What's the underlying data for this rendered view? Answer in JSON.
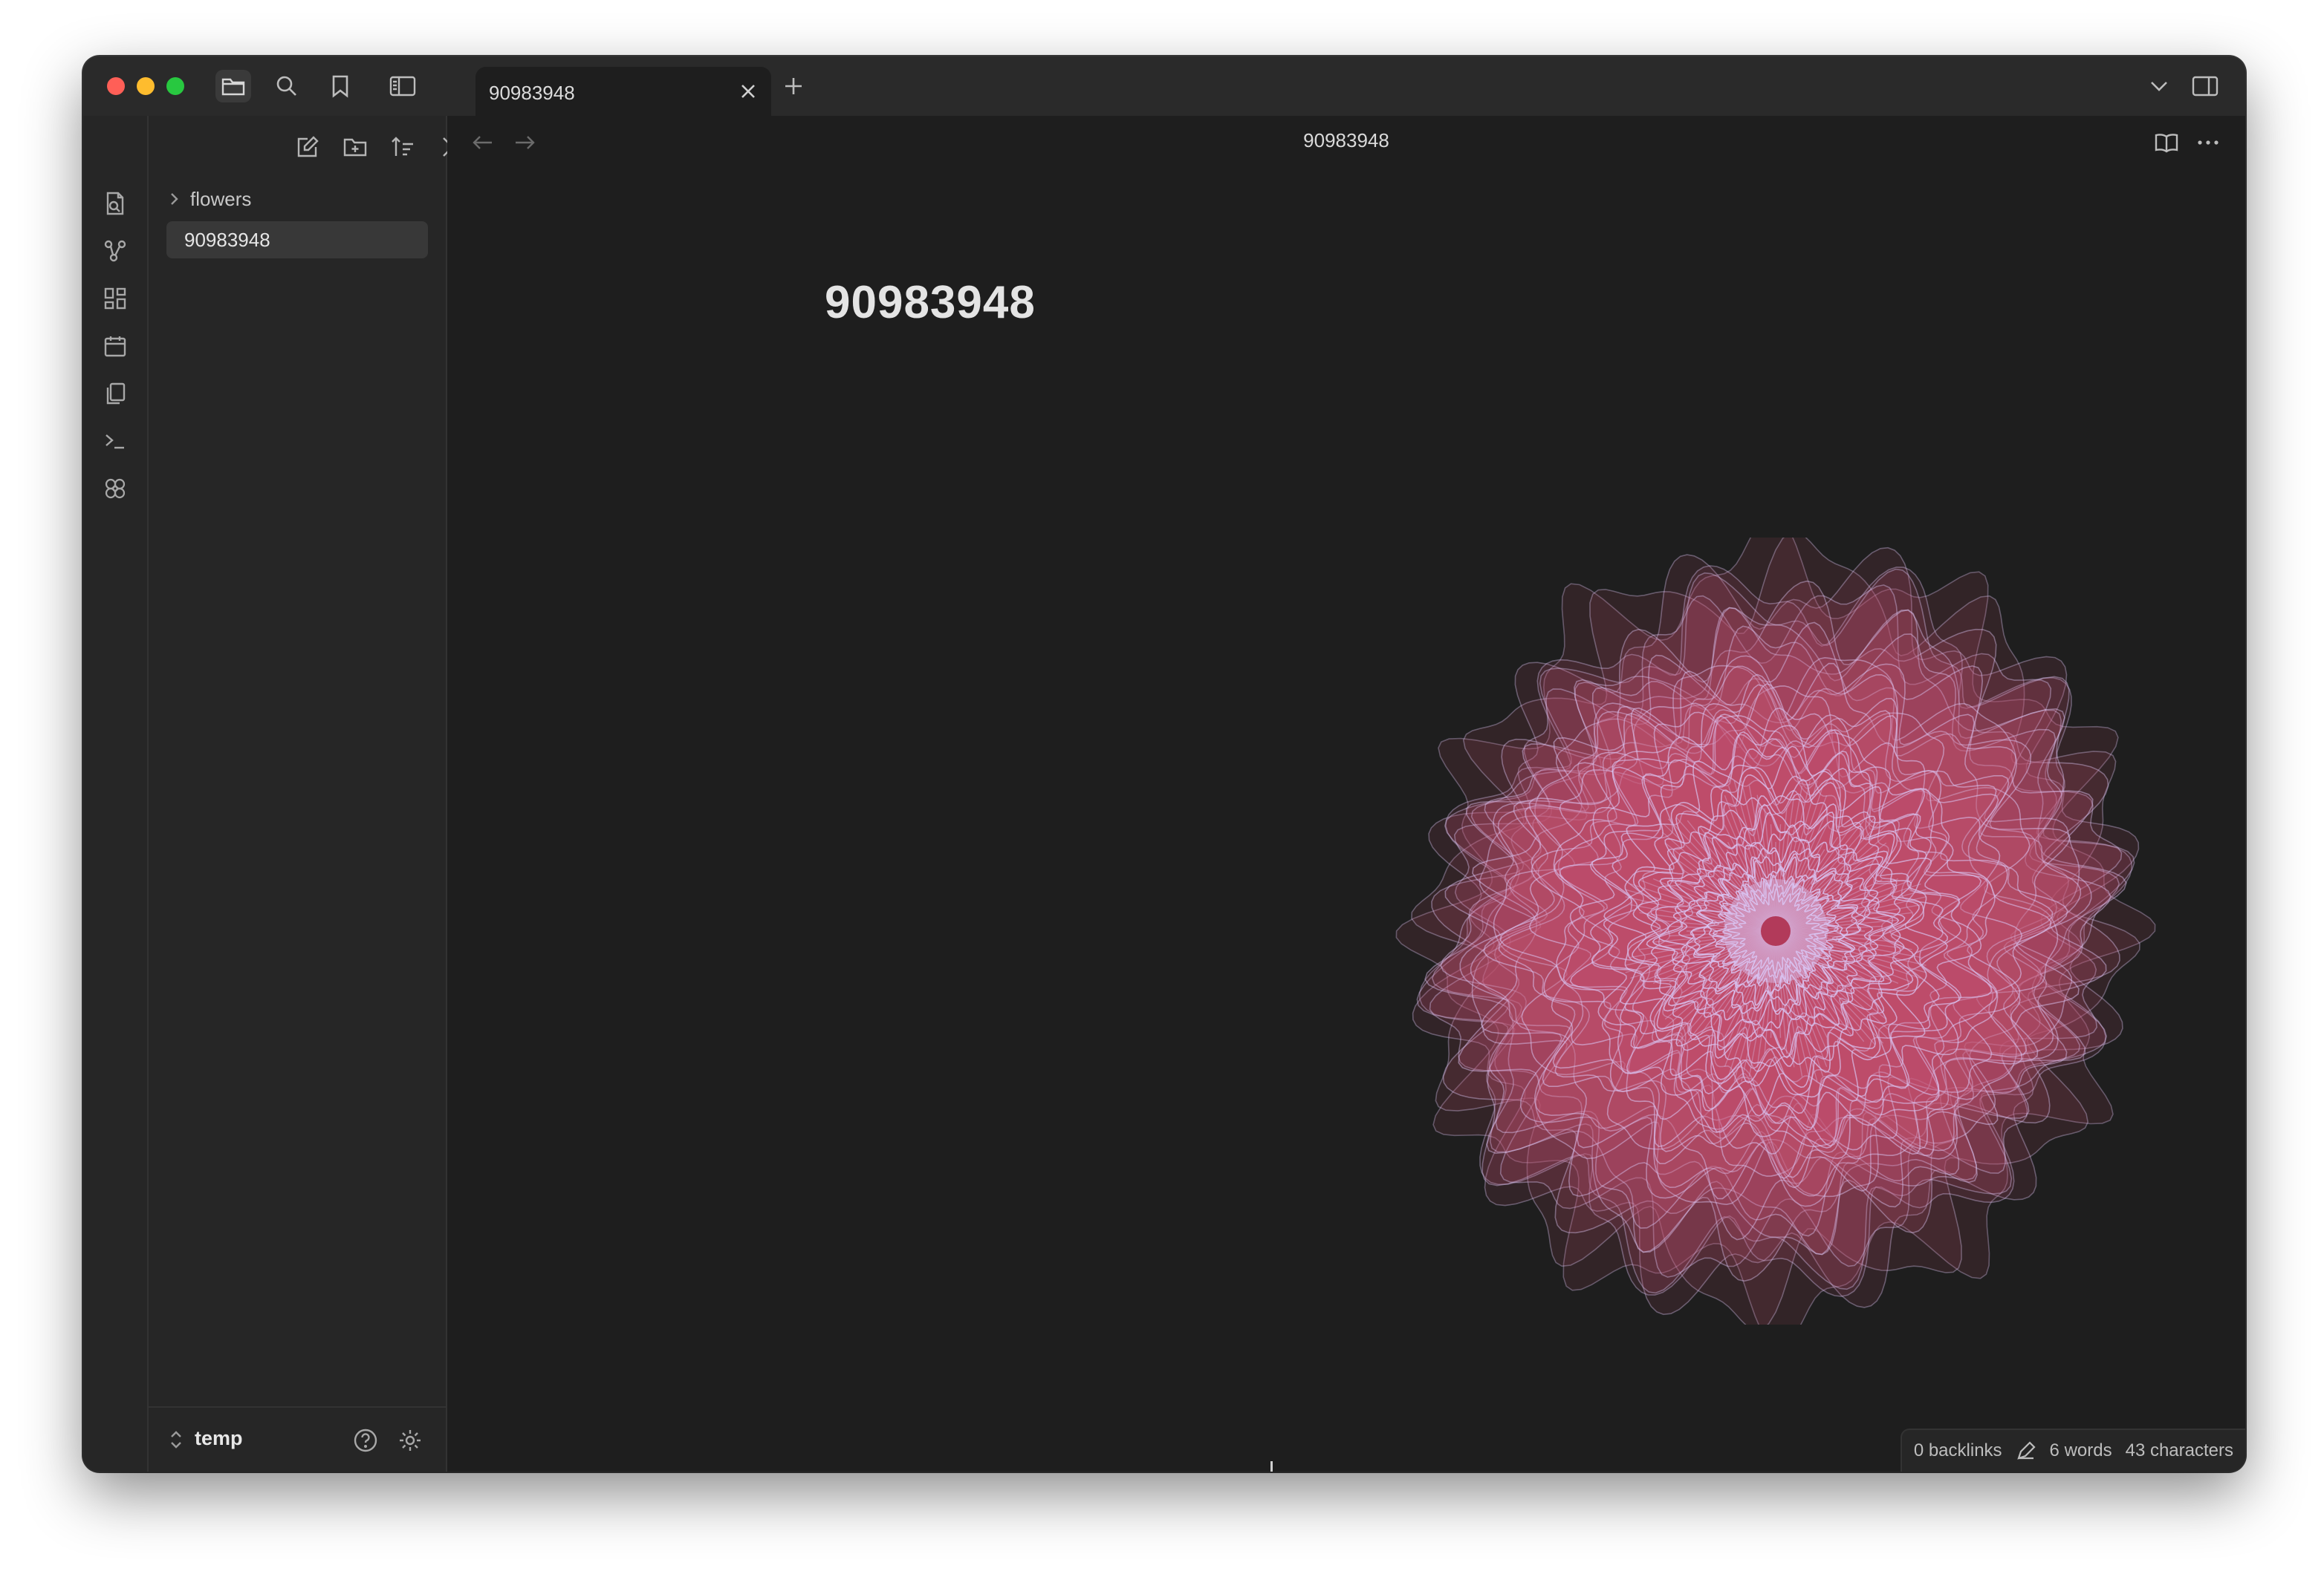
{
  "tab": {
    "title": "90983948"
  },
  "header": {
    "title": "90983948"
  },
  "sidebar": {
    "folder": "flowers",
    "file": "90983948",
    "vault": "temp"
  },
  "note": {
    "title": "90983948"
  },
  "status": {
    "backlinks": "0 backlinks",
    "words": "6 words",
    "characters": "43 characters"
  },
  "colors": {
    "petal_fill": "#c2506e",
    "petal_line": "#d9c4f2",
    "center": "#b23a5a"
  }
}
